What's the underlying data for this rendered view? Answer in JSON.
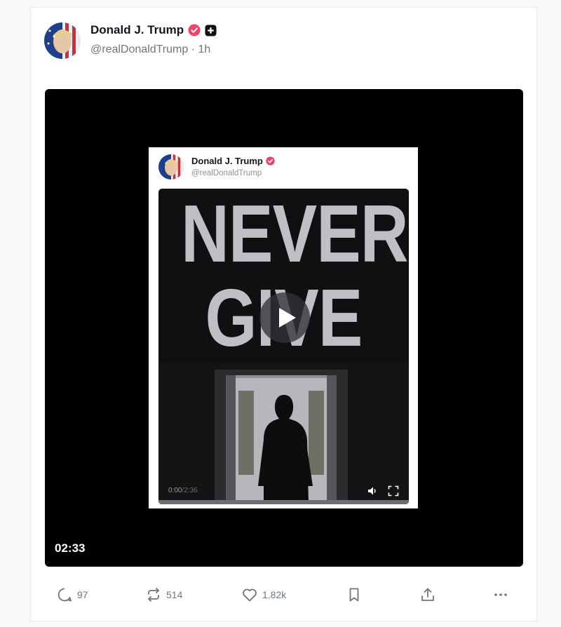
{
  "post": {
    "author_name": "Donald J. Trump",
    "author_handle": "@realDonaldTrump",
    "time_ago": "1h",
    "handle_separator": "·",
    "video_duration": "02:33"
  },
  "embedded": {
    "author_name": "Donald J. Trump",
    "author_handle": "@realDonaldTrump",
    "headline_line1": "NEVER",
    "headline_line2": "GIVE UP",
    "time_current": "0:00",
    "time_separator": "/",
    "time_total": "2:36"
  },
  "actions": {
    "reply_count": "97",
    "repost_count": "514",
    "like_count": "1.82k"
  },
  "colors": {
    "verified": "#f0436a",
    "text_primary": "#15171b",
    "text_secondary": "#6f7480",
    "video_bg": "#000000"
  },
  "icons": [
    "avatar",
    "verified-badge-icon",
    "plus-badge-icon",
    "play-icon",
    "volume-icon",
    "fullscreen-icon",
    "reply-icon",
    "repost-icon",
    "like-icon",
    "bookmark-icon",
    "share-icon",
    "more-icon"
  ]
}
